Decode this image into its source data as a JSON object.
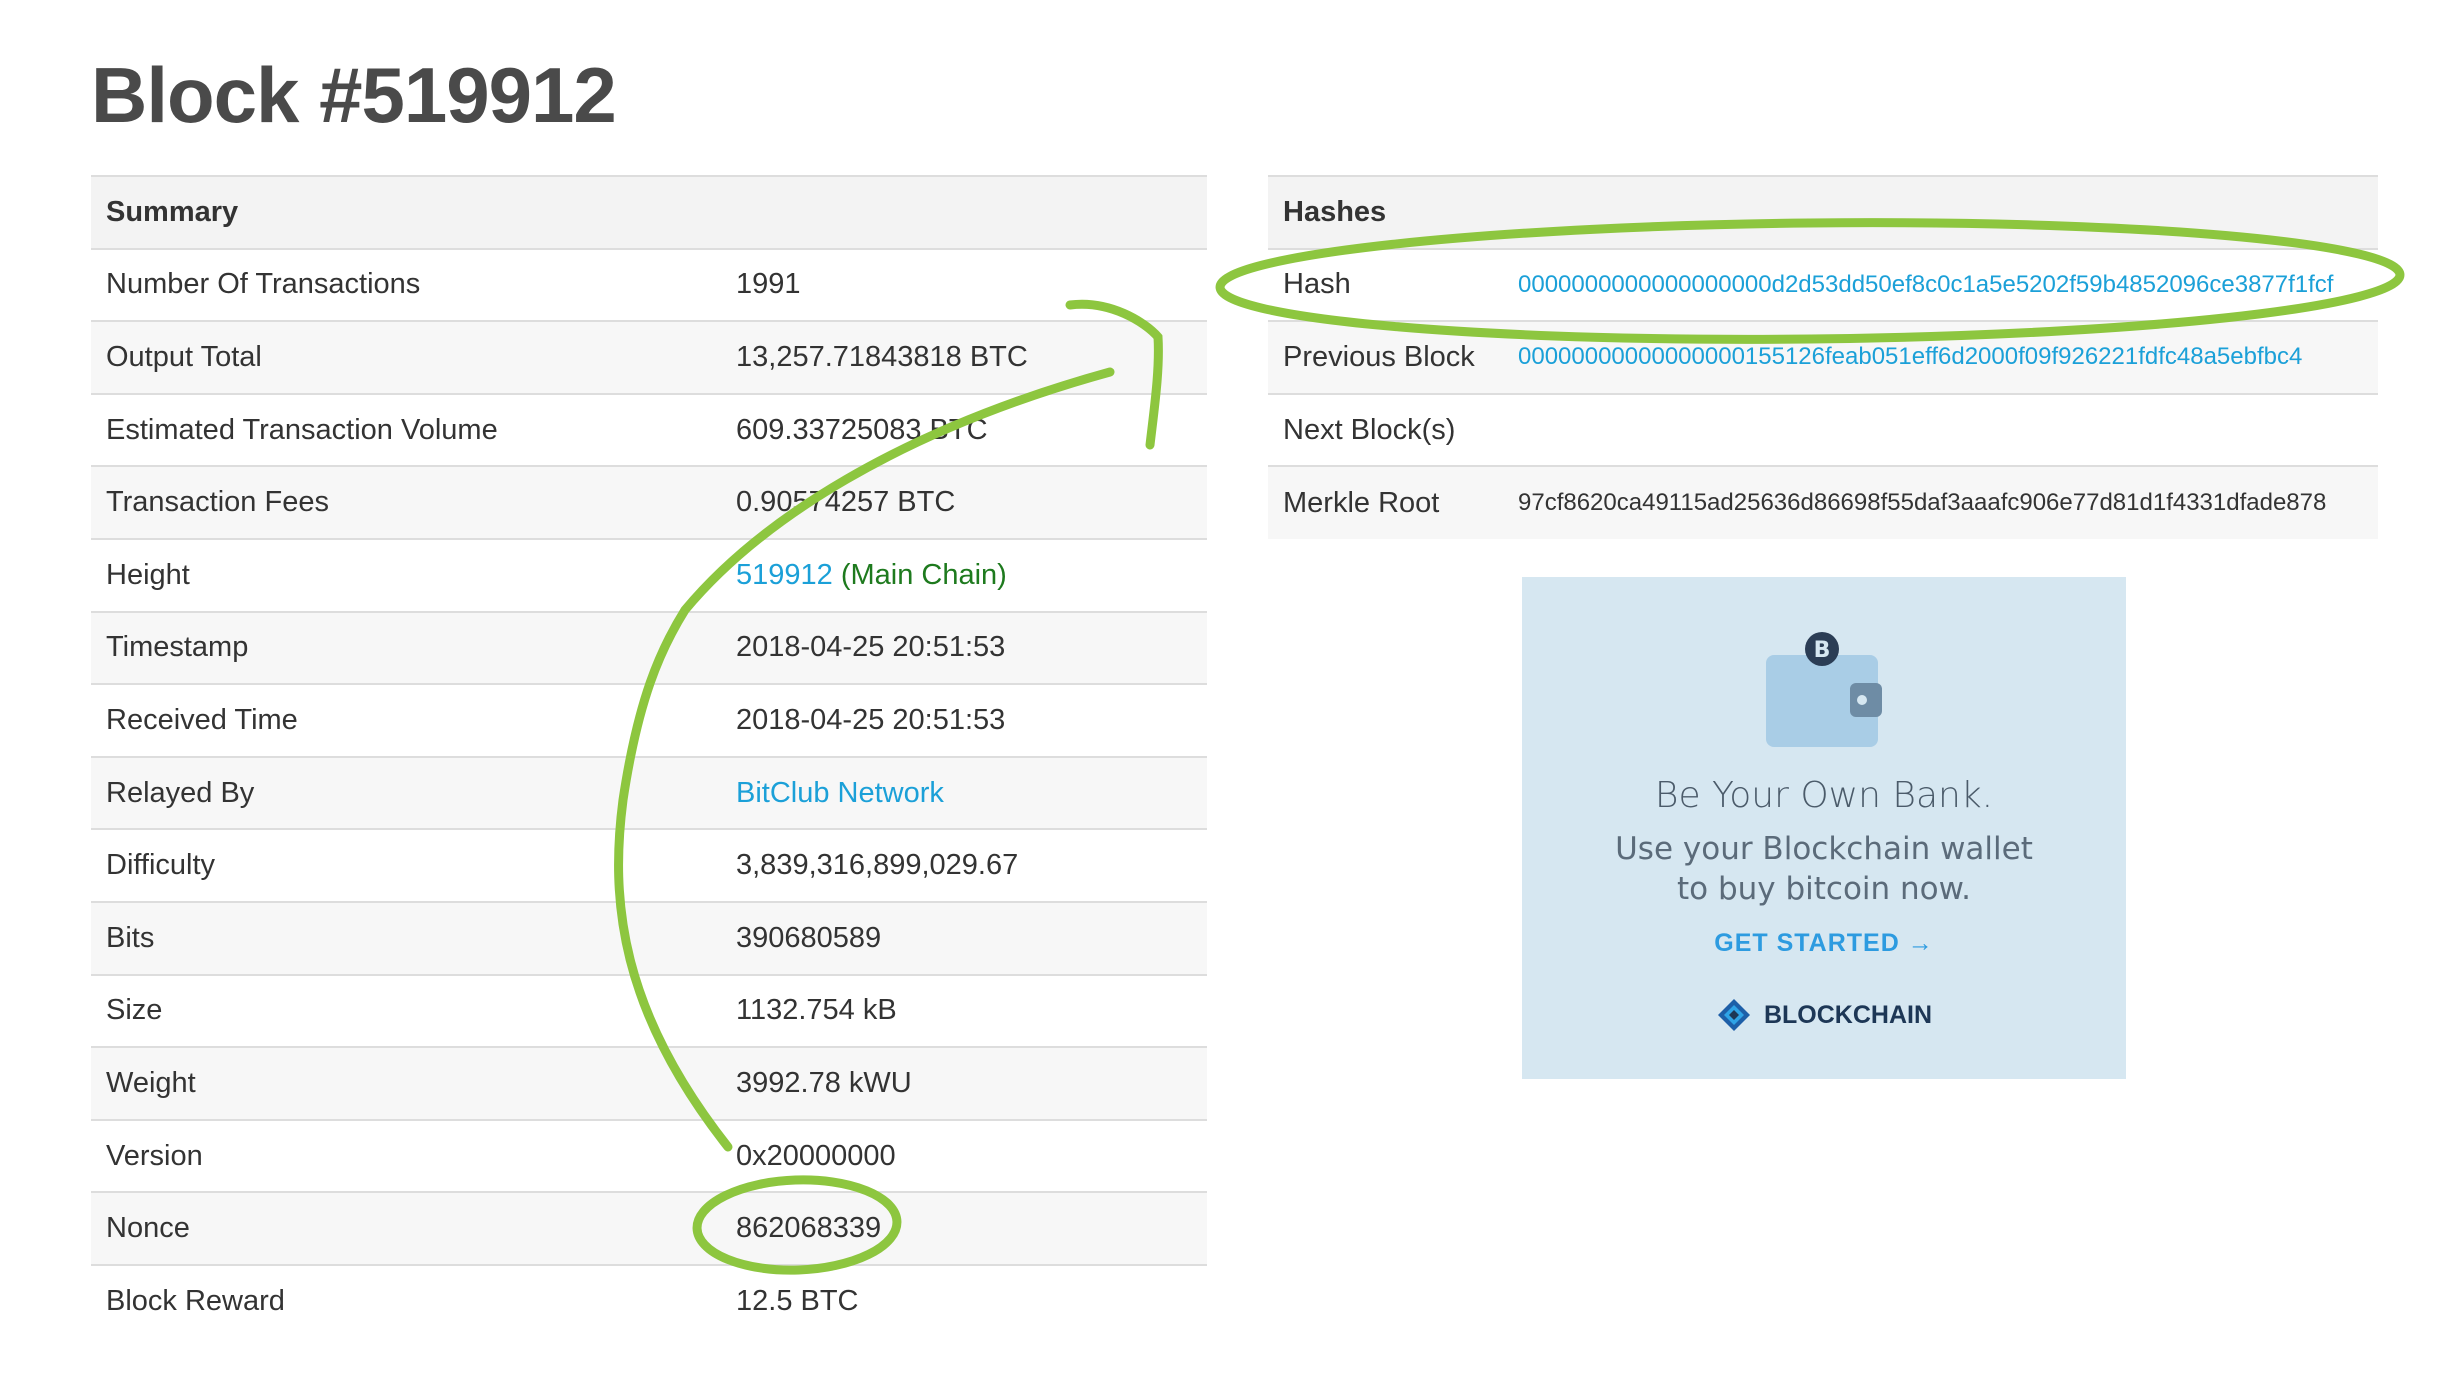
{
  "page": {
    "title": "Block #519912"
  },
  "summary": {
    "header": "Summary",
    "rows": [
      {
        "label": "Number Of Transactions",
        "value": "1991"
      },
      {
        "label": "Output Total",
        "value": "13,257.71843818 BTC"
      },
      {
        "label": "Estimated Transaction Volume",
        "value": "609.33725083 BTC"
      },
      {
        "label": "Transaction Fees",
        "value": "0.90574257 BTC"
      },
      {
        "label": "Height",
        "value": "519912",
        "value_extra": "(Main Chain)"
      },
      {
        "label": "Timestamp",
        "value": "2018-04-25 20:51:53"
      },
      {
        "label": "Received Time",
        "value": "2018-04-25 20:51:53"
      },
      {
        "label": "Relayed By",
        "value": "BitClub Network"
      },
      {
        "label": "Difficulty",
        "value": "3,839,316,899,029.67"
      },
      {
        "label": "Bits",
        "value": "390680589"
      },
      {
        "label": "Size",
        "value": "1132.754 kB"
      },
      {
        "label": "Weight",
        "value": "3992.78 kWU"
      },
      {
        "label": "Version",
        "value": "0x20000000"
      },
      {
        "label": "Nonce",
        "value": "862068339"
      },
      {
        "label": "Block Reward",
        "value": "12.5 BTC"
      }
    ]
  },
  "hashes": {
    "header": "Hashes",
    "rows": [
      {
        "label": "Hash",
        "value": "0000000000000000000d2d53dd50ef8c0c1a5e5202f59b4852096ce3877f1fcf"
      },
      {
        "label": "Previous Block",
        "value": "00000000000000000155126feab051eff6d2000f09f926221fdfc48a5ebfbc4"
      },
      {
        "label": "Next Block(s)",
        "value": ""
      },
      {
        "label": "Merkle Root",
        "value": "97cf8620ca49115ad25636d86698f55daf3aaafc906e77d81d1f4331dfade878"
      }
    ]
  },
  "ad": {
    "headline": "Be Your Own Bank.",
    "body_line1": "Use your Blockchain wallet",
    "body_line2": "to buy bitcoin now.",
    "cta": "GET STARTED →",
    "brand": "BLOCKCHAIN",
    "icons": [
      "wallet-icon",
      "bitcoin-coin-icon",
      "blockchain-logo-icon"
    ]
  },
  "annotations": {
    "color": "#8dc63f",
    "items": [
      "nonce-circle",
      "hash-circle",
      "arrow-nonce-to-hash"
    ]
  },
  "colors": {
    "link": "#1ba0d8",
    "main_chain": "#1e7a1e",
    "title": "#4a4a4a",
    "ad_background": "#d6e7f1"
  }
}
